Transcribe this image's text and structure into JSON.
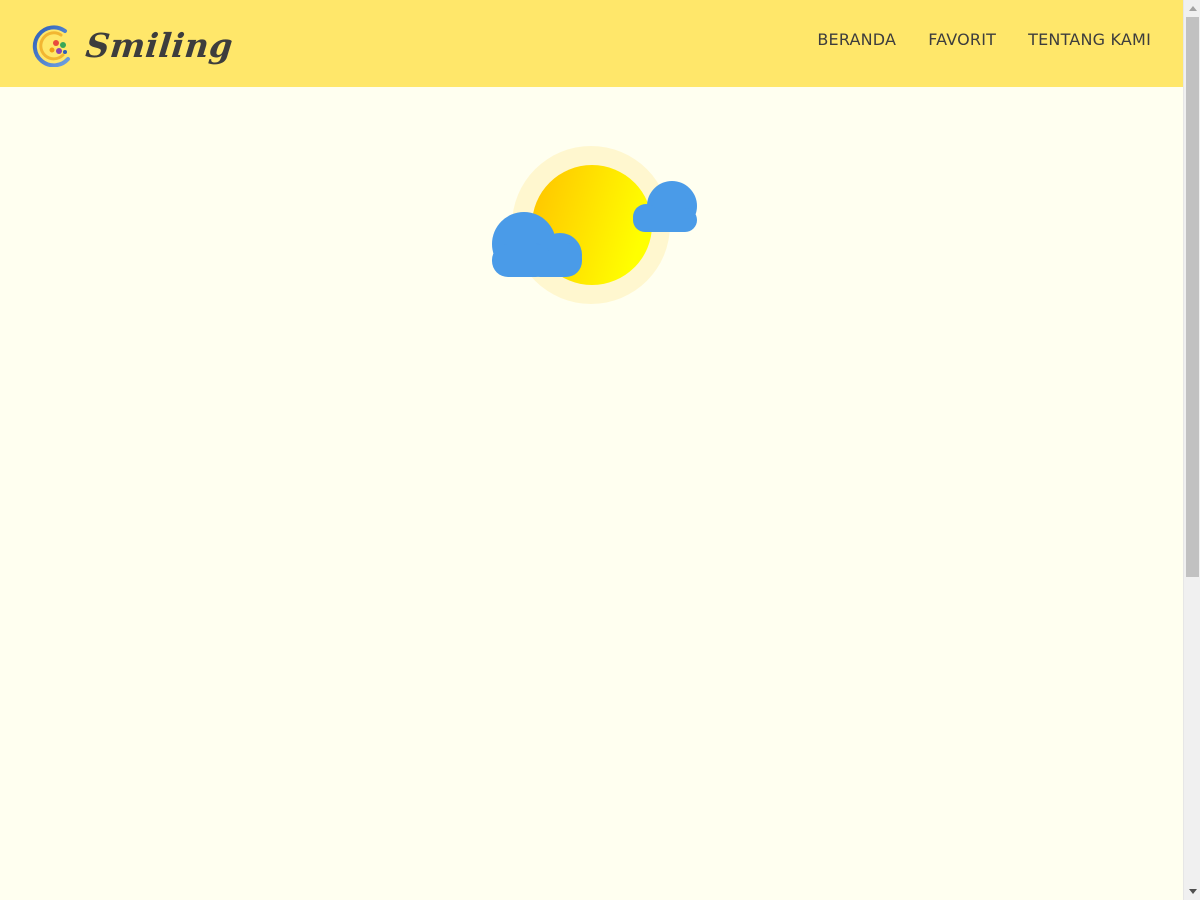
{
  "brand": {
    "name": "Smiling",
    "logo_icon": "smiling-logo-icon"
  },
  "nav": {
    "items": [
      {
        "label": "BERANDA"
      },
      {
        "label": "FAVORIT"
      },
      {
        "label": "TENTANG KAMI"
      }
    ]
  },
  "illustration": {
    "icon": "partly-cloudy-icon"
  },
  "colors": {
    "header_bg": "#ffe76a",
    "page_bg": "#fffff0",
    "text": "#3d3d3d",
    "sun": "#ffd000",
    "cloud": "#4a9be8"
  }
}
